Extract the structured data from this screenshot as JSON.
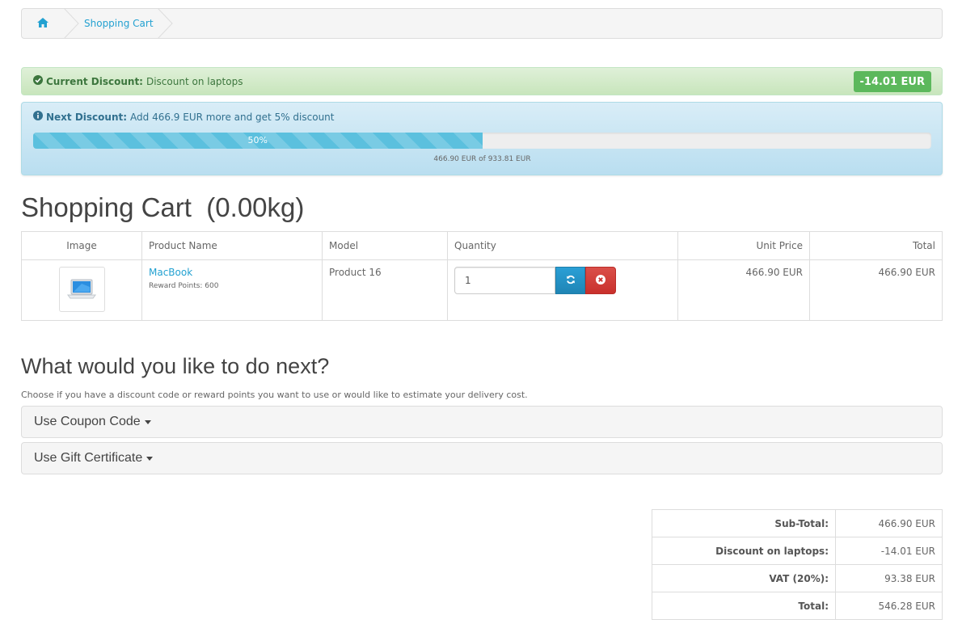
{
  "breadcrumb": {
    "home_icon": "home-icon",
    "items": [
      "Shopping Cart"
    ]
  },
  "current_discount": {
    "label": "Current Discount:",
    "text": "Discount on laptops",
    "amount": "-14.01 EUR",
    "icon": "check-circle-icon"
  },
  "next_discount": {
    "label": "Next Discount:",
    "text": "Add 466.9 EUR more and get 5% discount",
    "icon": "info-circle-icon",
    "progress_percent": 50,
    "progress_label": "50%",
    "progress_caption": "466.90 EUR of 933.81 EUR"
  },
  "cart": {
    "title": "Shopping Cart  (0.00kg)",
    "columns": {
      "image": "Image",
      "name": "Product Name",
      "model": "Model",
      "quantity": "Quantity",
      "unit_price": "Unit Price",
      "total": "Total"
    },
    "items": [
      {
        "name": "MacBook",
        "reward": "Reward Points: 600",
        "model": "Product 16",
        "quantity": "1",
        "unit_price": "466.90 EUR",
        "total": "466.90 EUR"
      }
    ]
  },
  "next": {
    "title": "What would you like to do next?",
    "description": "Choose if you have a discount code or reward points you want to use or would like to estimate your delivery cost.",
    "panels": [
      "Use Coupon Code",
      "Use Gift Certificate"
    ]
  },
  "totals": [
    {
      "label": "Sub-Total:",
      "value": "466.90 EUR"
    },
    {
      "label": "Discount on laptops:",
      "value": "-14.01 EUR"
    },
    {
      "label": "VAT (20%):",
      "value": "93.38 EUR"
    },
    {
      "label": "Total:",
      "value": "546.28 EUR"
    }
  ],
  "colors": {
    "link": "#23a1d1",
    "success": "#5cb85c",
    "info_bar": "#5bc0de",
    "refresh_button": "#2a9fd6",
    "remove_button": "#da4f49"
  }
}
